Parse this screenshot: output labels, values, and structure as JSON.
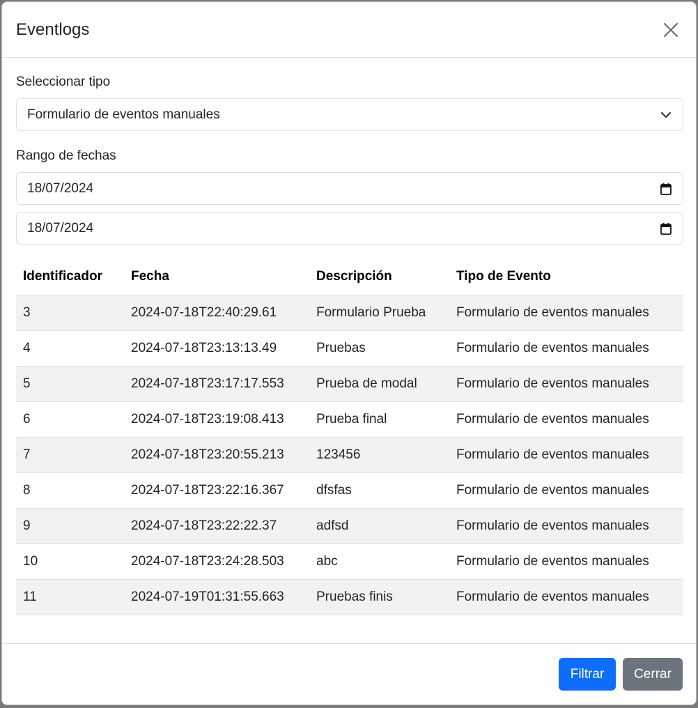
{
  "modal": {
    "title": "Eventlogs"
  },
  "filters": {
    "type_label": "Seleccionar tipo",
    "type_value": "Formulario de eventos manuales",
    "date_range_label": "Rango de fechas",
    "date_from": "18/07/2024",
    "date_to": "18/07/2024"
  },
  "table": {
    "headers": [
      "Identificador",
      "Fecha",
      "Descripción",
      "Tipo de Evento"
    ],
    "rows": [
      [
        "3",
        "2024-07-18T22:40:29.61",
        "Formulario Prueba",
        "Formulario de eventos manuales"
      ],
      [
        "4",
        "2024-07-18T23:13:13.49",
        "Pruebas",
        "Formulario de eventos manuales"
      ],
      [
        "5",
        "2024-07-18T23:17:17.553",
        "Prueba de modal",
        "Formulario de eventos manuales"
      ],
      [
        "6",
        "2024-07-18T23:19:08.413",
        "Prueba final",
        "Formulario de eventos manuales"
      ],
      [
        "7",
        "2024-07-18T23:20:55.213",
        "123456",
        "Formulario de eventos manuales"
      ],
      [
        "8",
        "2024-07-18T23:22:16.367",
        "dfsfas",
        "Formulario de eventos manuales"
      ],
      [
        "9",
        "2024-07-18T23:22:22.37",
        "adfsd",
        "Formulario de eventos manuales"
      ],
      [
        "10",
        "2024-07-18T23:24:28.503",
        "abc",
        "Formulario de eventos manuales"
      ],
      [
        "11",
        "2024-07-19T01:31:55.663",
        "Pruebas finis",
        "Formulario de eventos manuales"
      ]
    ]
  },
  "footer": {
    "filter_label": "Filtrar",
    "close_label": "Cerrar"
  },
  "colors": {
    "primary": "#0d6efd",
    "secondary": "#6c757d",
    "stripe": "#f2f2f2"
  },
  "icons": {
    "close": "close-icon",
    "select": "chevron-down-icon",
    "date": "calendar-icon"
  }
}
